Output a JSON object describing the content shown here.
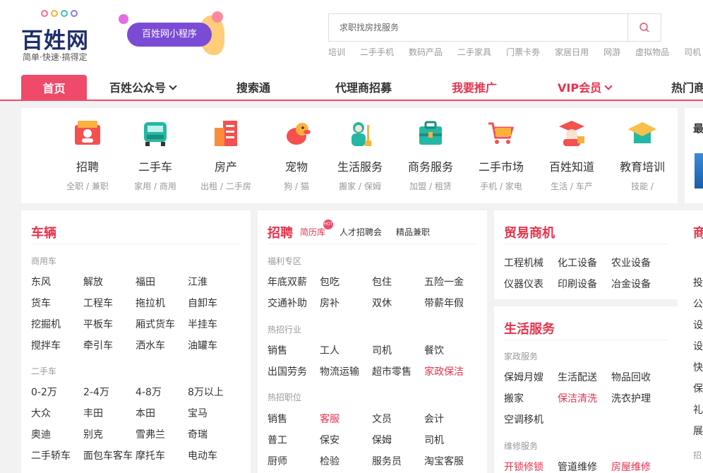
{
  "header": {
    "logo_title": "百姓网",
    "logo_slogan": "简单·快速·搞得定",
    "logo_dot_colors": [
      "#f56d9d",
      "#f8b234",
      "#3fc0b7",
      "#8f7be0"
    ],
    "mini_program_label": "百姓网小程序",
    "search_placeholder": "求职找房找服务",
    "hot_words": [
      "培训",
      "二手手机",
      "数码产品",
      "二手家具",
      "门票卡劵",
      "家居日用",
      "网游",
      "虚拟物品",
      "司机"
    ]
  },
  "nav": {
    "items": [
      {
        "label": "首页",
        "active": true
      },
      {
        "label": "百姓公众号",
        "dropdown": true
      },
      {
        "label": "搜索通"
      },
      {
        "label": "代理商招募"
      },
      {
        "label": "我要推广",
        "accent": true
      },
      {
        "label": "VIP会员",
        "accent": true,
        "dropdown": true
      },
      {
        "label": "热门商"
      }
    ]
  },
  "categories": [
    {
      "name": "招聘",
      "sub": "全职 / 兼职",
      "icon": "recruit-icon"
    },
    {
      "name": "二手车",
      "sub": "家用 / 商用",
      "icon": "used-car-icon"
    },
    {
      "name": "房产",
      "sub": "出租 / 二手房",
      "icon": "building-icon"
    },
    {
      "name": "宠物",
      "sub": "狗 / 猫",
      "icon": "dog-icon"
    },
    {
      "name": "生活服务",
      "sub": "搬家 / 保姆",
      "icon": "cleaner-icon"
    },
    {
      "name": "商务服务",
      "sub": "加盟 / 租赁",
      "icon": "briefcase-icon"
    },
    {
      "name": "二手市场",
      "sub": "手机 / 家电",
      "icon": "cart-icon"
    },
    {
      "name": "百姓知道",
      "sub": "生活 / 车产",
      "icon": "graduate-icon"
    },
    {
      "name": "教育培训",
      "sub": "技能 /",
      "icon": "mortarboard-icon"
    }
  ],
  "side_top": {
    "title": "最"
  },
  "vehicles": {
    "title": "车辆",
    "commercial_label": "商用车",
    "commercial_rows": [
      [
        "东风",
        "解放",
        "福田",
        "江淮"
      ],
      [
        "货车",
        "工程车",
        "拖拉机",
        "自卸车"
      ],
      [
        "挖掘机",
        "平板车",
        "厢式货车",
        "半挂车"
      ],
      [
        "搅拌车",
        "牵引车",
        "洒水车",
        "油罐车"
      ]
    ],
    "used_label": "二手车",
    "used_rows": [
      [
        "0-2万",
        "2-4万",
        "4-8万",
        "8万以上"
      ],
      [
        "大众",
        "丰田",
        "本田",
        "宝马"
      ],
      [
        "奥迪",
        "别克",
        "雪弗兰",
        "奇瑞"
      ],
      [
        "二手轿车",
        "面包车客车",
        "摩托车",
        "电动车"
      ]
    ]
  },
  "recruit": {
    "title": "招聘",
    "links": [
      {
        "label": "简历库",
        "accent": true
      },
      {
        "label": "人才招聘会"
      },
      {
        "label": "精品兼职"
      }
    ],
    "hot_badge": "HOT",
    "welfare_label": "福利专区",
    "welfare_rows": [
      [
        "年底双薪",
        "包吃",
        "包住",
        "五险一金"
      ],
      [
        "交通补助",
        "房补",
        "双休",
        "带薪年假"
      ]
    ],
    "industry_label": "热招行业",
    "industry_rows": [
      [
        {
          "t": "销售"
        },
        {
          "t": "工人"
        },
        {
          "t": "司机"
        },
        {
          "t": "餐饮"
        }
      ],
      [
        {
          "t": "出国劳务"
        },
        {
          "t": "物流运输"
        },
        {
          "t": "超市零售"
        },
        {
          "t": "家政保洁",
          "accent": true
        }
      ]
    ],
    "position_label": "热招职位",
    "position_rows": [
      [
        {
          "t": "销售"
        },
        {
          "t": "客服",
          "accent": true
        },
        {
          "t": "文员"
        },
        {
          "t": "会计"
        }
      ],
      [
        {
          "t": "普工"
        },
        {
          "t": "保安"
        },
        {
          "t": "保姆"
        },
        {
          "t": "司机"
        }
      ],
      [
        {
          "t": "厨师"
        },
        {
          "t": "检验"
        },
        {
          "t": "服务员"
        },
        {
          "t": "淘宝客服"
        }
      ]
    ]
  },
  "trade": {
    "title": "贸易商机",
    "rows": [
      [
        "工程机械",
        "化工设备",
        "农业设备"
      ],
      [
        "仪器仪表",
        "印刷设备",
        "冶金设备"
      ]
    ]
  },
  "life": {
    "title": "生活服务",
    "housekeeping_label": "家政服务",
    "housekeeping_rows": [
      [
        {
          "t": "保姆月嫂"
        },
        {
          "t": "生活配送"
        },
        {
          "t": "物品回收"
        }
      ],
      [
        {
          "t": "搬家"
        },
        {
          "t": "保洁清洗",
          "accent": true
        },
        {
          "t": "洗衣护理"
        }
      ],
      [
        {
          "t": "空调移机"
        }
      ]
    ],
    "repair_label": "维修服务",
    "repair_rows": [
      [
        {
          "t": "开锁修锁",
          "accent": true
        },
        {
          "t": "管道维修"
        },
        {
          "t": "房屋维修",
          "accent": true
        }
      ]
    ]
  },
  "side_panel": {
    "title": "商",
    "items": [
      "投",
      "公",
      "设",
      "设",
      "快",
      "保",
      "礼",
      "展",
      "招"
    ]
  },
  "colors": {
    "accent": "#ef4a69",
    "accent_text": "#e8324c",
    "brand_navy": "#1f2f6e",
    "mini_program": "#7a4cd6"
  }
}
